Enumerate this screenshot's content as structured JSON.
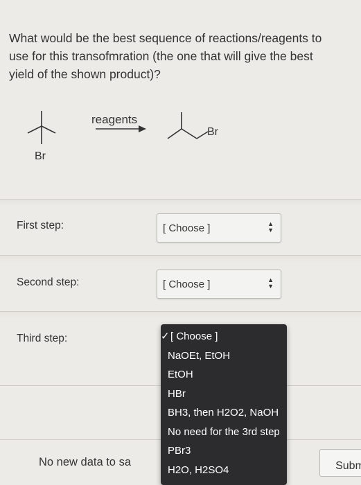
{
  "question": {
    "line1": "What would be the best sequence of reactions/reagents to",
    "line2": "use for this transofmration (the one that will give the best",
    "line3": "yield of the shown product)?"
  },
  "scheme": {
    "reactant_label": "Br",
    "arrow_label": "reagents",
    "product_label": "Br"
  },
  "steps": [
    {
      "label": "First step:",
      "selected": "[ Choose ]"
    },
    {
      "label": "Second step:",
      "selected": "[ Choose ]"
    },
    {
      "label": "Third step:"
    }
  ],
  "dropdown": {
    "checkmark": "✓",
    "options": [
      "[ Choose ]",
      "NaOEt, EtOH",
      "EtOH",
      "HBr",
      "BH3, then H2O2, NaOH",
      "No need for the 3rd step",
      "PBr3",
      "H2O, H2SO4"
    ],
    "selected_index": 0
  },
  "footer": {
    "status_text": "No new data to sa",
    "submit_label": "Subm"
  }
}
